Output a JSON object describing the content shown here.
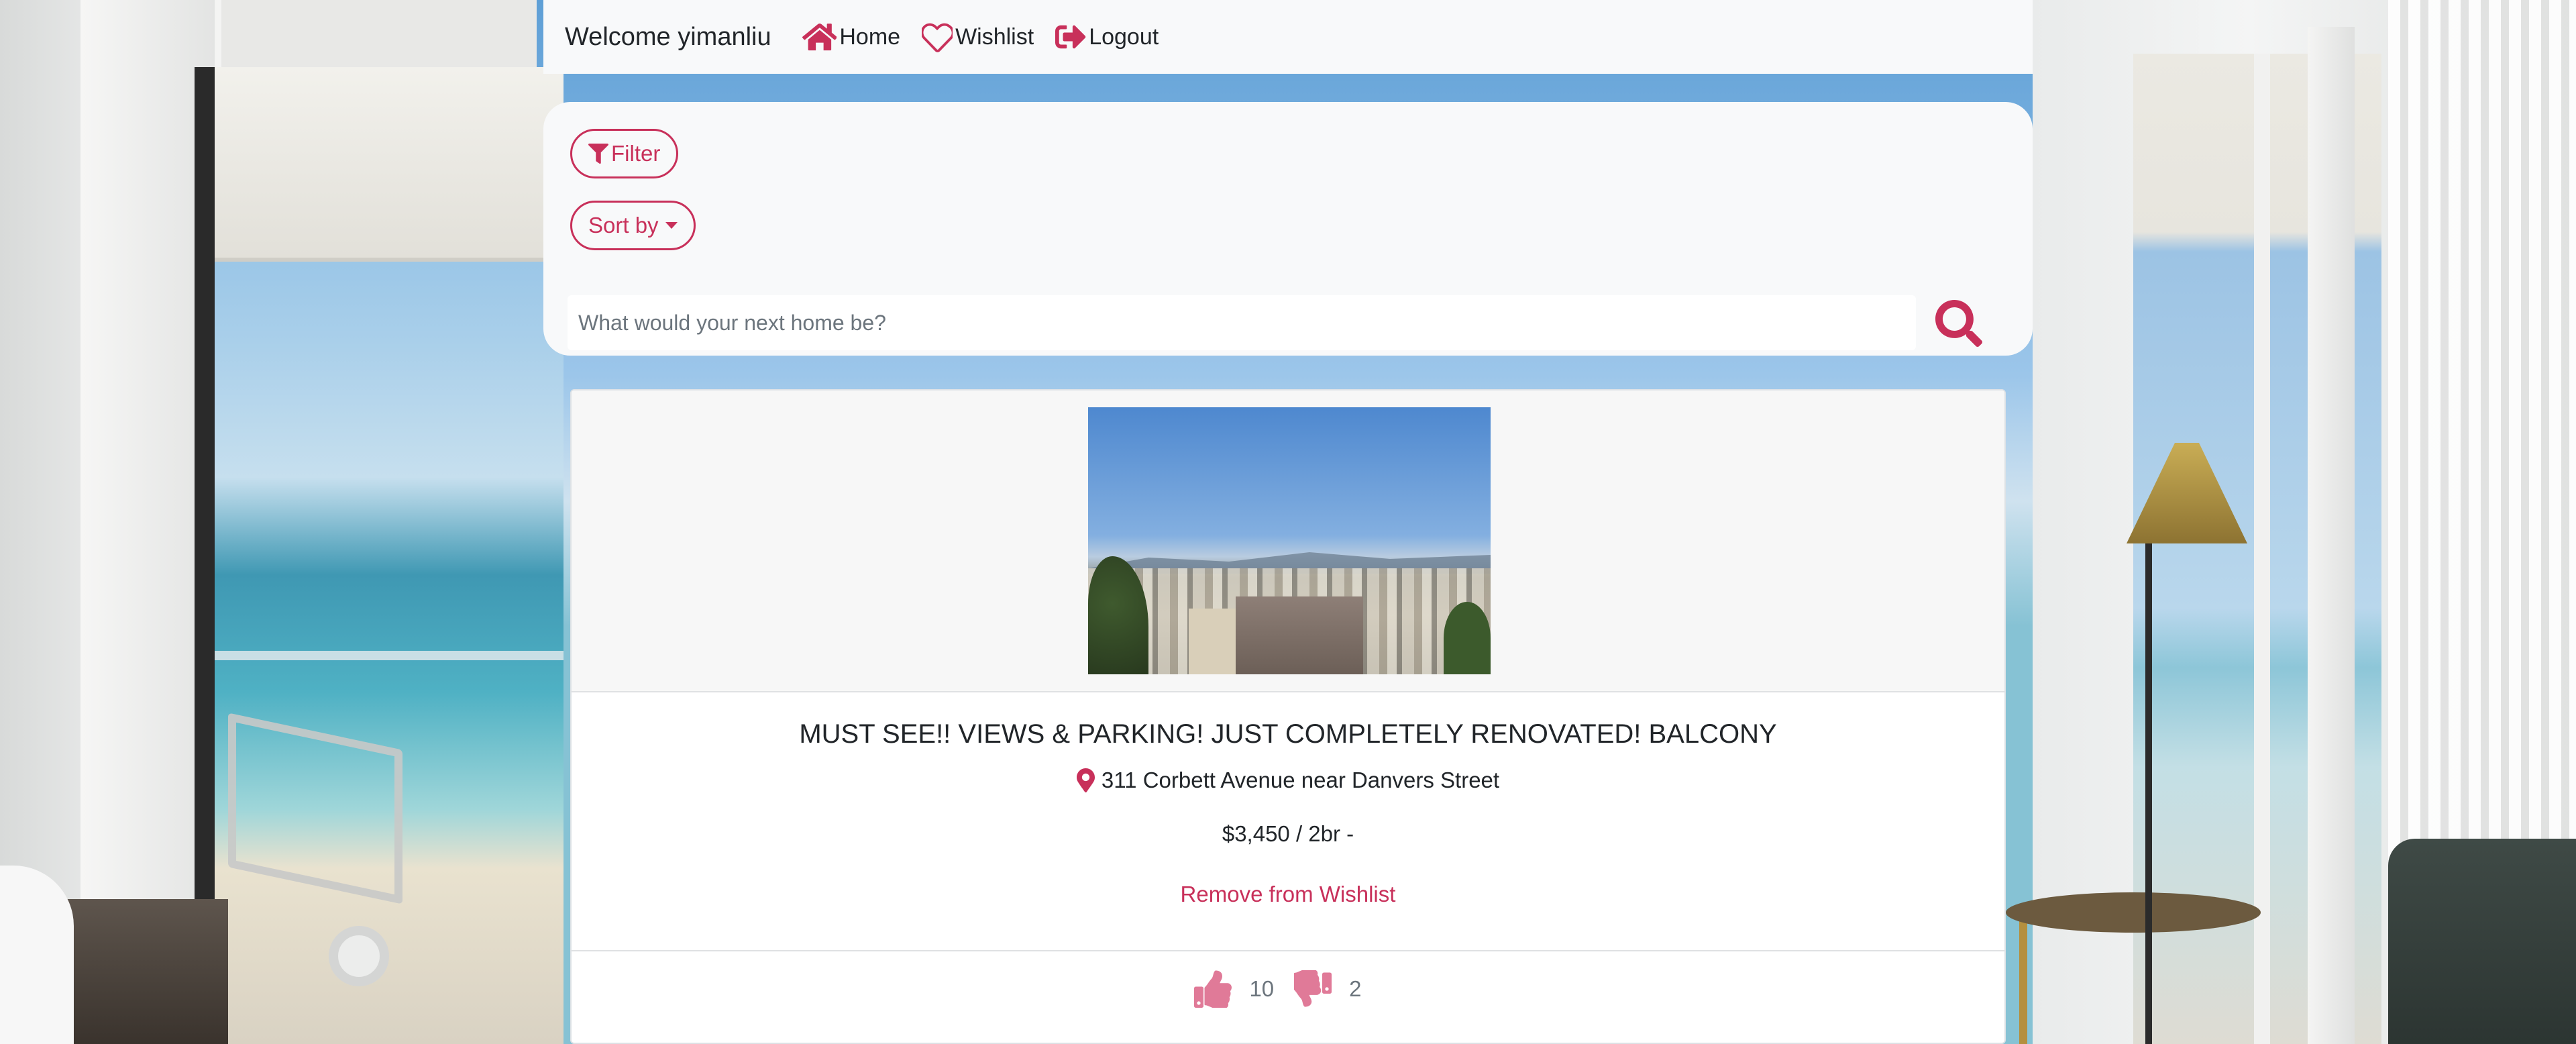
{
  "navbar": {
    "welcome": "Welcome yimanliu",
    "links": [
      {
        "label": "Home",
        "icon": "home-icon"
      },
      {
        "label": "Wishlist",
        "icon": "heart-icon"
      },
      {
        "label": "Logout",
        "icon": "sign-out-icon"
      }
    ]
  },
  "filters": {
    "filter_label": "Filter",
    "sort_label": "Sort by",
    "search_placeholder": "What would your next home be?",
    "search_value": ""
  },
  "listing": {
    "title": "MUST SEE!! VIEWS & PARKING! JUST COMPLETELY RENOVATED! BALCONY",
    "address": "311 Corbett Avenue near Danvers Street",
    "price": "$3,450 / 2br -",
    "action_label": "Remove from Wishlist",
    "likes": "10",
    "dislikes": "2"
  },
  "colors": {
    "accent": "#c8305a",
    "thumbs": "#e07a98",
    "panel": "#f8f9fa"
  }
}
